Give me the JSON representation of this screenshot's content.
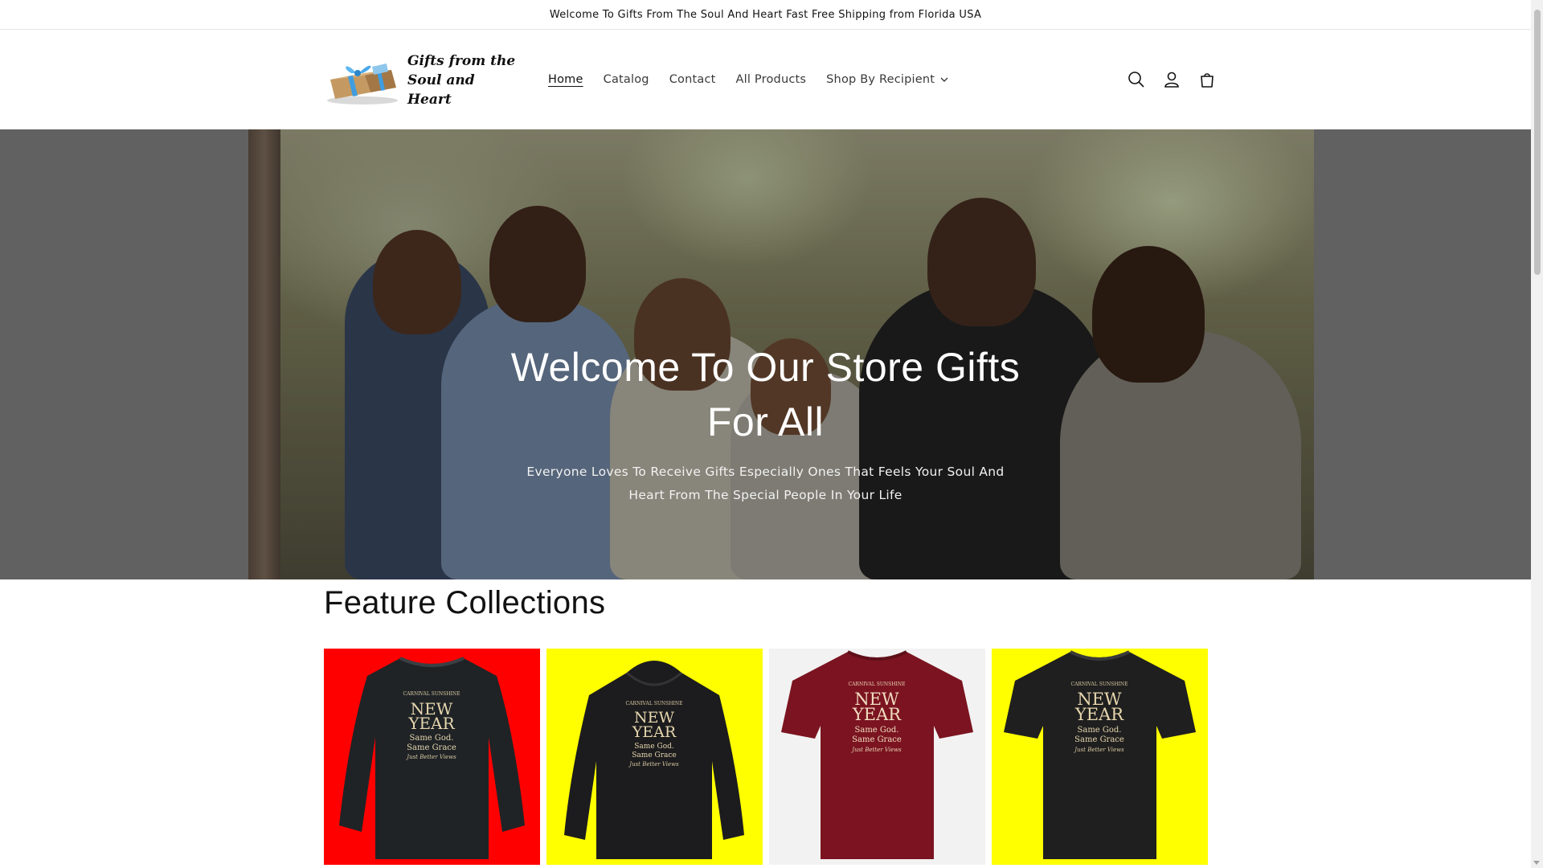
{
  "announcement": {
    "text": "Welcome To Gifts From The Soul And Heart Fast Free Shipping from Florida USA"
  },
  "header": {
    "logo_line1": "Gifts from the",
    "logo_line2": "Soul and Heart",
    "nav": [
      {
        "label": "Home",
        "active": true
      },
      {
        "label": "Catalog",
        "active": false
      },
      {
        "label": "Contact",
        "active": false
      },
      {
        "label": "All Products",
        "active": false
      },
      {
        "label": "Shop By Recipient",
        "active": false,
        "has_dropdown": true
      }
    ],
    "icons": [
      "search-icon",
      "account-icon",
      "cart-icon"
    ]
  },
  "hero": {
    "title": "Welcome To Our Store Gifts For All",
    "subtitle": "Everyone Loves To Receive Gifts Especially Ones That Feels Your Soul And Heart From The Special People In Your Life"
  },
  "collections": {
    "title": "Feature Collections",
    "items": [
      {
        "name": "long-sleeve-black",
        "background": "#ff0000",
        "garment": "#1f2326",
        "print_line1": "NEW",
        "print_line2": "YEAR"
      },
      {
        "name": "hoodie-black",
        "background": "#ffff00",
        "garment": "#1c1c1e",
        "print_line1": "NEW",
        "print_line2": "YEAR"
      },
      {
        "name": "tshirt-maroon",
        "background": "#f2f2f2",
        "garment": "#7b1420",
        "print_line1": "NEW",
        "print_line2": "YEAR"
      },
      {
        "name": "tshirt-black",
        "background": "#ffff00",
        "garment": "#1f1f1f",
        "print_line1": "NEW",
        "print_line2": "YEAR"
      }
    ]
  },
  "colors": {
    "text": "#121212",
    "hero_gray": "#8f8f8f"
  }
}
